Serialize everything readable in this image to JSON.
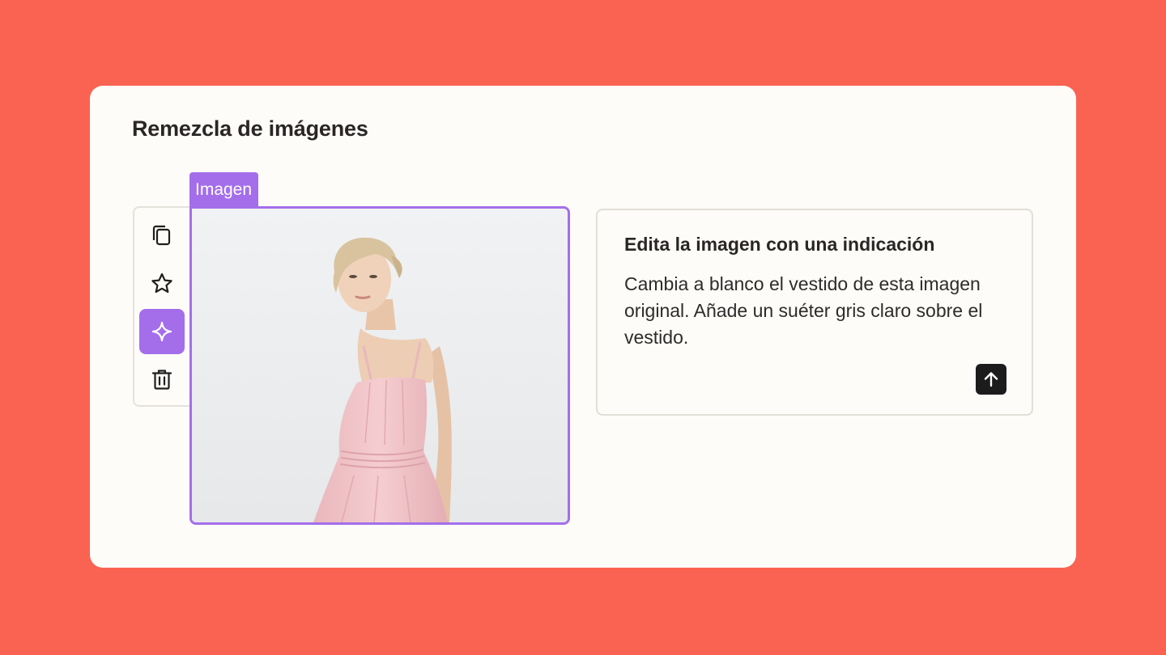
{
  "card": {
    "title": "Remezcla de imágenes"
  },
  "toolbar": {
    "items": [
      {
        "name": "copy",
        "icon": "copy-icon",
        "active": false
      },
      {
        "name": "favorite",
        "icon": "star-icon",
        "active": false
      },
      {
        "name": "magic-edit",
        "icon": "sparkle-icon",
        "active": true
      },
      {
        "name": "delete",
        "icon": "trash-icon",
        "active": false
      }
    ]
  },
  "image": {
    "tag_label": "Imagen"
  },
  "prompt": {
    "title": "Edita la imagen con una indicación",
    "text": "Cambia a blanco el vestido de esta imagen original. Añade un suéter gris claro sobre el vestido.",
    "send_icon": "arrow-up-icon"
  },
  "colors": {
    "background": "#FA6352",
    "card": "#FEFCF8",
    "accent": "#A46EEB",
    "send_button": "#1C1C1C"
  }
}
